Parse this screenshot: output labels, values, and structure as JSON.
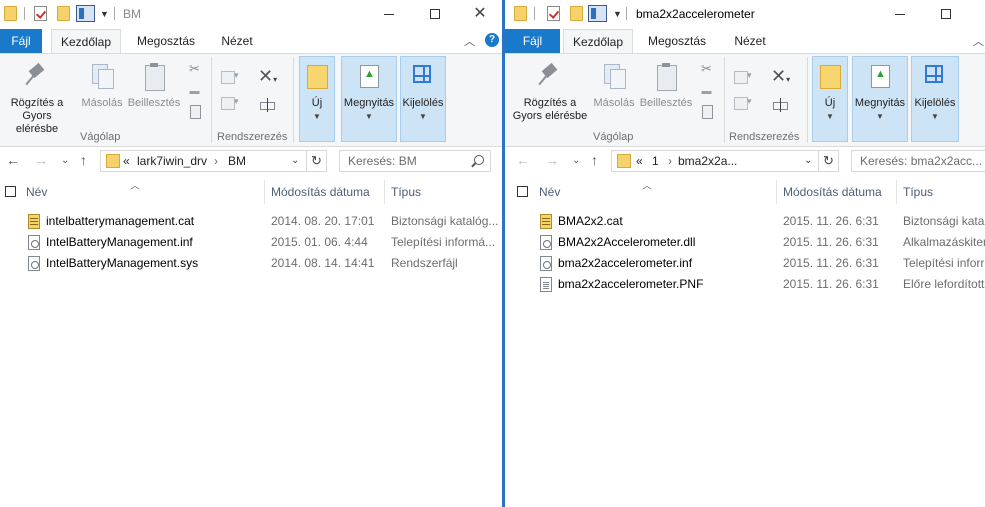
{
  "left": {
    "title": "BM",
    "ribbon_tabs": [
      "Fájl",
      "Kezdőlap",
      "Megosztás",
      "Nézet"
    ],
    "ribbon": {
      "pin": "Rögzítés a Gyors elérésbe",
      "copy": "Másolás",
      "paste": "Beillesztés",
      "clipboard_group": "Vágólap",
      "organize_group": "Rendszerezés",
      "new": "Új",
      "open": "Megnyitás",
      "select": "Kijelölés"
    },
    "address": {
      "overflow": "«",
      "crumbs": [
        "lark7iwin_drv",
        "BM"
      ]
    },
    "search_placeholder": "Keresés: BM",
    "columns": {
      "name": "Név",
      "date": "Módosítás dátuma",
      "type": "Típus"
    },
    "files": [
      {
        "name": "intelbatterymanagement.cat",
        "date": "2014. 08. 20. 17:01",
        "type": "Biztonsági katalóg...",
        "icon": "catalog-file-icon"
      },
      {
        "name": "IntelBatteryManagement.inf",
        "date": "2015. 01. 06. 4:44",
        "type": "Telepítési informá...",
        "icon": "setup-info-file-icon"
      },
      {
        "name": "IntelBatteryManagement.sys",
        "date": "2014. 08. 14. 14:41",
        "type": "Rendszerfájl",
        "icon": "system-file-icon"
      }
    ]
  },
  "right": {
    "title": "bma2x2accelerometer",
    "ribbon_tabs": [
      "Fájl",
      "Kezdőlap",
      "Megosztás",
      "Nézet"
    ],
    "ribbon": {
      "pin": "Rögzítés a Gyors elérésbe",
      "copy": "Másolás",
      "paste": "Beillesztés",
      "clipboard_group": "Vágólap",
      "organize_group": "Rendszerezés",
      "new": "Új",
      "open": "Megnyitás",
      "select": "Kijelölés"
    },
    "address": {
      "overflow": "«",
      "crumbs": [
        "1",
        "bma2x2a..."
      ]
    },
    "search_placeholder": "Keresés: bma2x2acc...",
    "columns": {
      "name": "Név",
      "date": "Módosítás dátuma",
      "type": "Típus"
    },
    "files": [
      {
        "name": "BMA2x2.cat",
        "date": "2015. 11. 26. 6:31",
        "type": "Biztonsági katal",
        "icon": "catalog-file-icon"
      },
      {
        "name": "BMA2x2Accelerometer.dll",
        "date": "2015. 11. 26. 6:31",
        "type": "Alkalmazáskiter",
        "icon": "dll-file-icon"
      },
      {
        "name": "bma2x2accelerometer.inf",
        "date": "2015. 11. 26. 6:31",
        "type": "Telepítési inforr",
        "icon": "setup-info-file-icon"
      },
      {
        "name": "bma2x2accelerometer.PNF",
        "date": "2015. 11. 26. 6:31",
        "type": "Előre lefordított",
        "icon": "precompiled-file-icon"
      }
    ]
  },
  "colors": {
    "accent": "#1979ca",
    "ribbon_bg": "#f5f6f7",
    "header_text": "#4c607a",
    "meta_text": "#6d6d6d"
  }
}
